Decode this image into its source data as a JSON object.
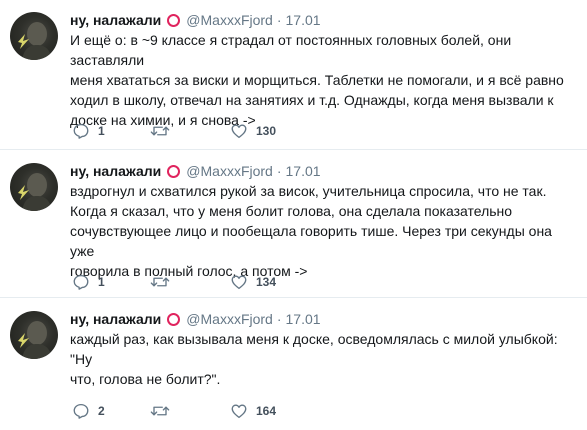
{
  "tweets": [
    {
      "name": "ну, налажали",
      "handle": "@MaxxxFjord",
      "separator": "·",
      "date": "17.01",
      "text": "И ещё о: в ~9 классе я страдал от постоянных головных болей, они заставляли\nменя хвататься за виски и морщиться. Таблетки не помогали, и я всё равно\nходил в школу, отвечал на занятиях и т.д. Однажды, когда меня вызвали к\nдоске на химии, и я снова ->",
      "replies": "1",
      "retweets": "",
      "likes": "130"
    },
    {
      "name": "ну, налажали",
      "handle": "@MaxxxFjord",
      "separator": "·",
      "date": "17.01",
      "text": "вздрогнул и схватился рукой за висок, учительница спросила, что не так.\nКогда я сказал, что у меня болит голова, она сделала показательно\nсочувствующее лицо и пообещала говорить тише. Через три секунды она уже\nговорила в полный голос, а потом ->",
      "replies": "1",
      "retweets": "",
      "likes": "134"
    },
    {
      "name": "ну, налажали",
      "handle": "@MaxxxFjord",
      "separator": "·",
      "date": "17.01",
      "text": "каждый раз, как вызывала меня к доске, осведомлялась с милой улыбкой: \"Ну\nчто, голова не болит?\".",
      "replies": "2",
      "retweets": "",
      "likes": "164"
    }
  ],
  "icons": {
    "avatar": "avatar-photo",
    "badge": "red-circle-badge",
    "reply": "reply-icon",
    "retweet": "retweet-icon",
    "like": "heart-icon"
  },
  "colors": {
    "text": "#14171a",
    "muted": "#657786",
    "badge": "#e0245e",
    "divider": "#e6ecf0"
  }
}
